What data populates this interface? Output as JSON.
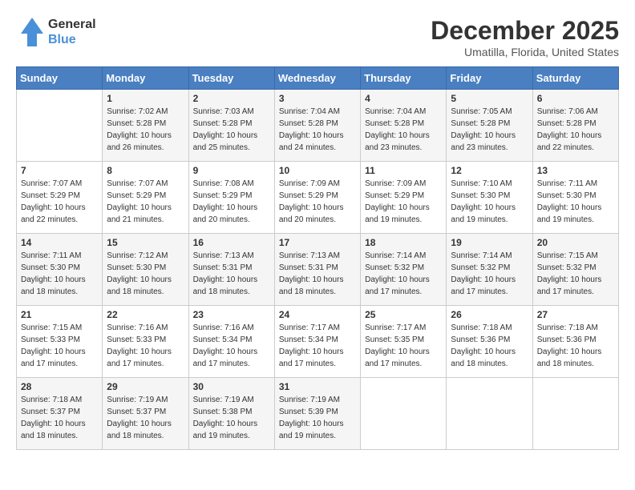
{
  "header": {
    "logo_line1": "General",
    "logo_line2": "Blue",
    "month": "December 2025",
    "location": "Umatilla, Florida, United States"
  },
  "weekdays": [
    "Sunday",
    "Monday",
    "Tuesday",
    "Wednesday",
    "Thursday",
    "Friday",
    "Saturday"
  ],
  "weeks": [
    [
      {
        "day": "",
        "info": ""
      },
      {
        "day": "1",
        "info": "Sunrise: 7:02 AM\nSunset: 5:28 PM\nDaylight: 10 hours\nand 26 minutes."
      },
      {
        "day": "2",
        "info": "Sunrise: 7:03 AM\nSunset: 5:28 PM\nDaylight: 10 hours\nand 25 minutes."
      },
      {
        "day": "3",
        "info": "Sunrise: 7:04 AM\nSunset: 5:28 PM\nDaylight: 10 hours\nand 24 minutes."
      },
      {
        "day": "4",
        "info": "Sunrise: 7:04 AM\nSunset: 5:28 PM\nDaylight: 10 hours\nand 23 minutes."
      },
      {
        "day": "5",
        "info": "Sunrise: 7:05 AM\nSunset: 5:28 PM\nDaylight: 10 hours\nand 23 minutes."
      },
      {
        "day": "6",
        "info": "Sunrise: 7:06 AM\nSunset: 5:28 PM\nDaylight: 10 hours\nand 22 minutes."
      }
    ],
    [
      {
        "day": "7",
        "info": "Sunrise: 7:07 AM\nSunset: 5:29 PM\nDaylight: 10 hours\nand 22 minutes."
      },
      {
        "day": "8",
        "info": "Sunrise: 7:07 AM\nSunset: 5:29 PM\nDaylight: 10 hours\nand 21 minutes."
      },
      {
        "day": "9",
        "info": "Sunrise: 7:08 AM\nSunset: 5:29 PM\nDaylight: 10 hours\nand 20 minutes."
      },
      {
        "day": "10",
        "info": "Sunrise: 7:09 AM\nSunset: 5:29 PM\nDaylight: 10 hours\nand 20 minutes."
      },
      {
        "day": "11",
        "info": "Sunrise: 7:09 AM\nSunset: 5:29 PM\nDaylight: 10 hours\nand 19 minutes."
      },
      {
        "day": "12",
        "info": "Sunrise: 7:10 AM\nSunset: 5:30 PM\nDaylight: 10 hours\nand 19 minutes."
      },
      {
        "day": "13",
        "info": "Sunrise: 7:11 AM\nSunset: 5:30 PM\nDaylight: 10 hours\nand 19 minutes."
      }
    ],
    [
      {
        "day": "14",
        "info": "Sunrise: 7:11 AM\nSunset: 5:30 PM\nDaylight: 10 hours\nand 18 minutes."
      },
      {
        "day": "15",
        "info": "Sunrise: 7:12 AM\nSunset: 5:30 PM\nDaylight: 10 hours\nand 18 minutes."
      },
      {
        "day": "16",
        "info": "Sunrise: 7:13 AM\nSunset: 5:31 PM\nDaylight: 10 hours\nand 18 minutes."
      },
      {
        "day": "17",
        "info": "Sunrise: 7:13 AM\nSunset: 5:31 PM\nDaylight: 10 hours\nand 18 minutes."
      },
      {
        "day": "18",
        "info": "Sunrise: 7:14 AM\nSunset: 5:32 PM\nDaylight: 10 hours\nand 17 minutes."
      },
      {
        "day": "19",
        "info": "Sunrise: 7:14 AM\nSunset: 5:32 PM\nDaylight: 10 hours\nand 17 minutes."
      },
      {
        "day": "20",
        "info": "Sunrise: 7:15 AM\nSunset: 5:32 PM\nDaylight: 10 hours\nand 17 minutes."
      }
    ],
    [
      {
        "day": "21",
        "info": "Sunrise: 7:15 AM\nSunset: 5:33 PM\nDaylight: 10 hours\nand 17 minutes."
      },
      {
        "day": "22",
        "info": "Sunrise: 7:16 AM\nSunset: 5:33 PM\nDaylight: 10 hours\nand 17 minutes."
      },
      {
        "day": "23",
        "info": "Sunrise: 7:16 AM\nSunset: 5:34 PM\nDaylight: 10 hours\nand 17 minutes."
      },
      {
        "day": "24",
        "info": "Sunrise: 7:17 AM\nSunset: 5:34 PM\nDaylight: 10 hours\nand 17 minutes."
      },
      {
        "day": "25",
        "info": "Sunrise: 7:17 AM\nSunset: 5:35 PM\nDaylight: 10 hours\nand 17 minutes."
      },
      {
        "day": "26",
        "info": "Sunrise: 7:18 AM\nSunset: 5:36 PM\nDaylight: 10 hours\nand 18 minutes."
      },
      {
        "day": "27",
        "info": "Sunrise: 7:18 AM\nSunset: 5:36 PM\nDaylight: 10 hours\nand 18 minutes."
      }
    ],
    [
      {
        "day": "28",
        "info": "Sunrise: 7:18 AM\nSunset: 5:37 PM\nDaylight: 10 hours\nand 18 minutes."
      },
      {
        "day": "29",
        "info": "Sunrise: 7:19 AM\nSunset: 5:37 PM\nDaylight: 10 hours\nand 18 minutes."
      },
      {
        "day": "30",
        "info": "Sunrise: 7:19 AM\nSunset: 5:38 PM\nDaylight: 10 hours\nand 19 minutes."
      },
      {
        "day": "31",
        "info": "Sunrise: 7:19 AM\nSunset: 5:39 PM\nDaylight: 10 hours\nand 19 minutes."
      },
      {
        "day": "",
        "info": ""
      },
      {
        "day": "",
        "info": ""
      },
      {
        "day": "",
        "info": ""
      }
    ]
  ]
}
